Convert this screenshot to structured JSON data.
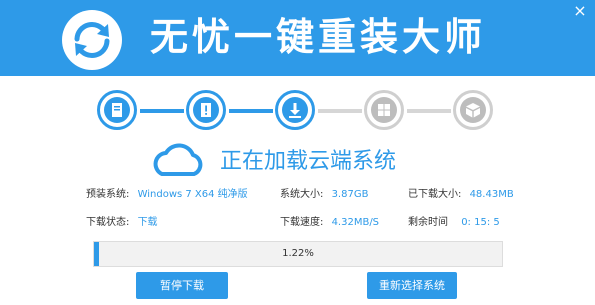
{
  "app": {
    "title": "无忧一键重装大师",
    "close_label": "×"
  },
  "steps": [
    {
      "icon": "document-icon",
      "state": "complete"
    },
    {
      "icon": "alert-document-icon",
      "state": "complete"
    },
    {
      "icon": "download-icon",
      "state": "current"
    },
    {
      "icon": "windows-icon",
      "state": "pending"
    },
    {
      "icon": "package-icon",
      "state": "pending"
    }
  ],
  "status": {
    "icon": "cloud-icon",
    "title": "正在加载云端系统"
  },
  "info": {
    "system_label": "预装系统:",
    "system_value": "Windows 7  X64 纯净版",
    "size_label": "系统大小:",
    "size_value": "3.87GB",
    "downloaded_label": "已下载大小:",
    "downloaded_value": "48.43MB",
    "state_label": "下载状态:",
    "state_value": "下载",
    "speed_label": "下载速度:",
    "speed_value": "4.32MB/S",
    "remaining_label": "剩余时间",
    "remaining_value": "0: 15: 5"
  },
  "progress": {
    "percent": 1.22,
    "label": "1.22%"
  },
  "buttons": {
    "pause_label": "暂停下载",
    "reselect_label": "重新选择系统"
  },
  "colors": {
    "accent": "#2e9ae8",
    "inactive": "#bdbdbd"
  }
}
